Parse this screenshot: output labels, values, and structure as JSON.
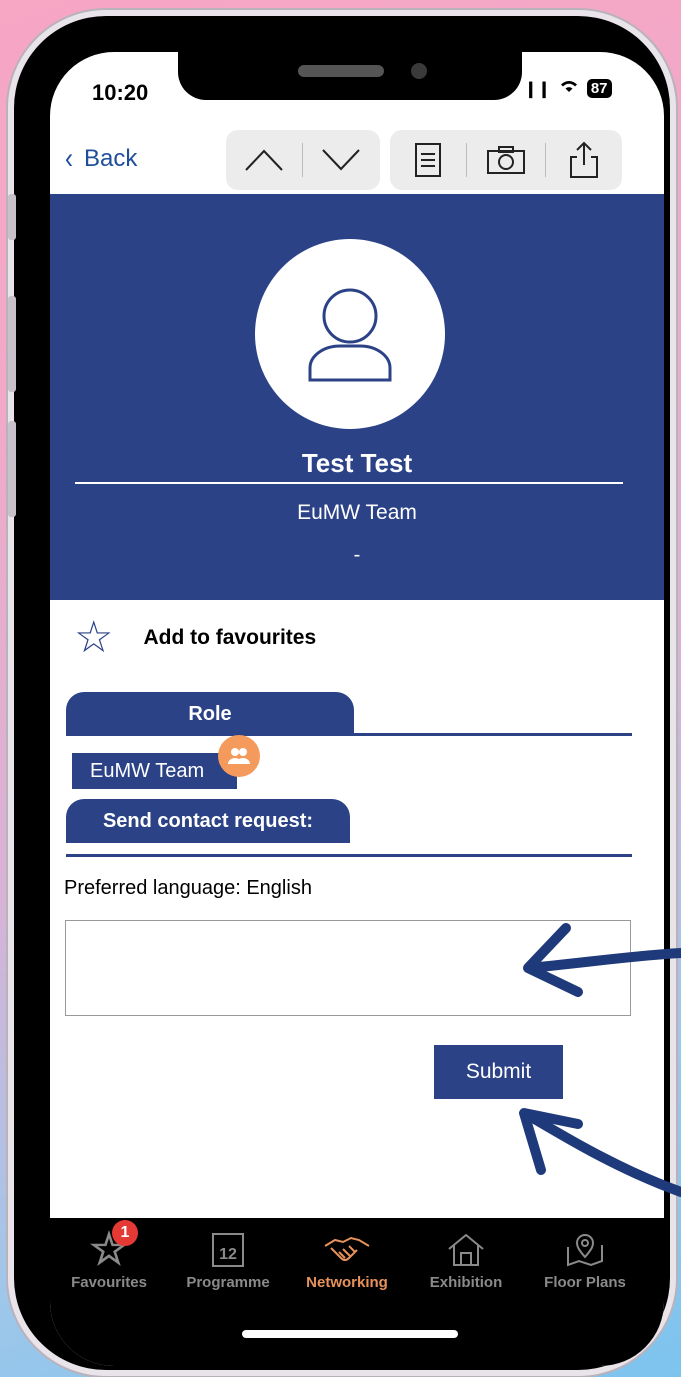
{
  "status": {
    "time": "10:20",
    "signal": "❙❙",
    "wifi": "◠",
    "battery": "87"
  },
  "nav": {
    "back_label": "Back",
    "up_icon": "chevron-up-icon",
    "down_icon": "chevron-down-icon",
    "notes_icon": "notes-icon",
    "camera_icon": "camera-icon",
    "share_icon": "share-icon"
  },
  "profile": {
    "name": "Test Test",
    "company": "EuMW Team",
    "detail": "-"
  },
  "favourites": {
    "label": "Add to favourites"
  },
  "role": {
    "tab_label": "Role",
    "chip": "EuMW Team"
  },
  "contact": {
    "tab_label": "Send contact request:",
    "preferred_language": "Preferred language: English",
    "message_value": "",
    "submit_label": "Submit"
  },
  "tabbar": {
    "items": [
      {
        "label": "Favourites",
        "badge": "1"
      },
      {
        "label": "Programme",
        "icon_text": "12"
      },
      {
        "label": "Networking"
      },
      {
        "label": "Exhibition"
      },
      {
        "label": "Floor Plans"
      }
    ],
    "active": "Networking"
  },
  "colors": {
    "brand_blue": "#2b4287",
    "accent_orange": "#e8925a",
    "badge_red": "#e53935",
    "link_blue": "#1f4e9a"
  }
}
